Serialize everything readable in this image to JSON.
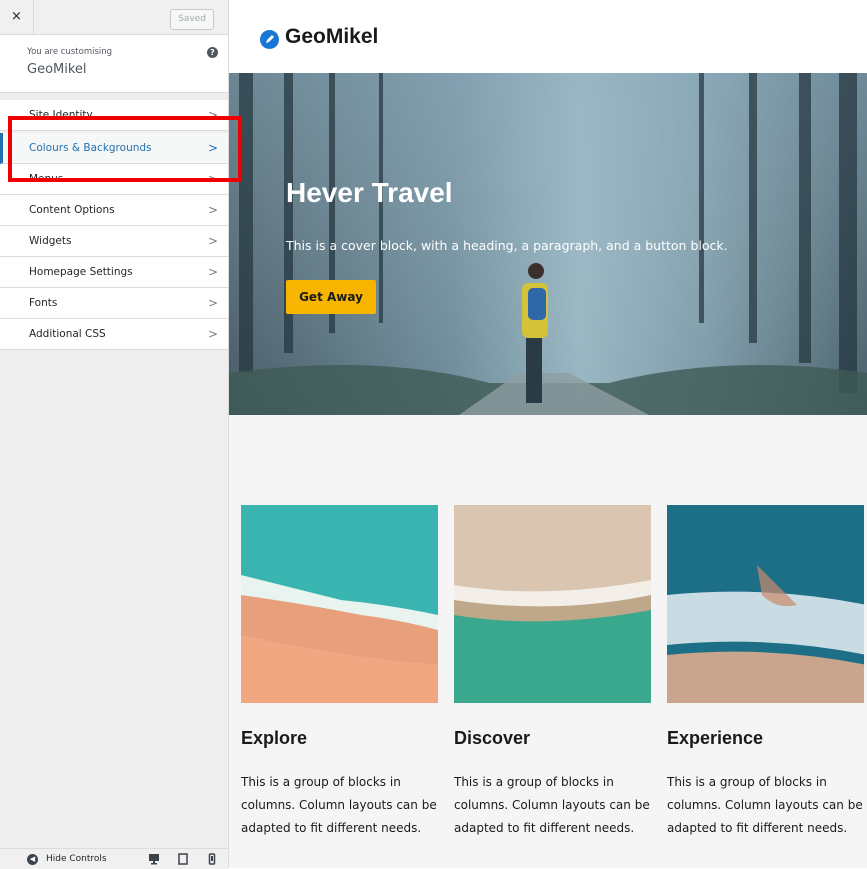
{
  "sidebar": {
    "close_label": "×",
    "saved_label": "Saved",
    "customizing_label": "You are customising",
    "site_name": "GeoMikel",
    "help_icon": "?",
    "items": [
      {
        "label": "Site Identity",
        "icon": "chevron-right-icon"
      },
      {
        "label": "Colours & Backgrounds",
        "icon": "chevron-right-icon"
      },
      {
        "label": "Menus",
        "icon": "chevron-right-icon"
      },
      {
        "label": "Content Options",
        "icon": "chevron-right-icon"
      },
      {
        "label": "Widgets",
        "icon": "chevron-right-icon"
      },
      {
        "label": "Homepage Settings",
        "icon": "chevron-right-icon"
      },
      {
        "label": "Fonts",
        "icon": "chevron-right-icon"
      },
      {
        "label": "Additional CSS",
        "icon": "chevron-right-icon"
      }
    ],
    "active_item": "Colours & Backgrounds",
    "chevron": ">",
    "footer": {
      "hide_label": "Hide Controls"
    }
  },
  "preview": {
    "site_title": "GeoMikel",
    "cover": {
      "title": "Hever Travel",
      "text": "This is a cover block, with a heading, a paragraph, and a button block.",
      "button_label": "Get Away"
    },
    "columns": [
      {
        "title": "Explore",
        "text": "This is a group of blocks in columns. Column layouts can be adapted to fit different needs."
      },
      {
        "title": "Discover",
        "text": "This is a group of blocks in columns. Column layouts can be adapted to fit different needs."
      },
      {
        "title": "Experience",
        "text": "This is a group of blocks in columns. Column layouts can be adapted to fit different needs."
      }
    ]
  },
  "colors": {
    "accent": "#2271b1",
    "button": "#f7b500",
    "highlight": "#ee0000"
  }
}
